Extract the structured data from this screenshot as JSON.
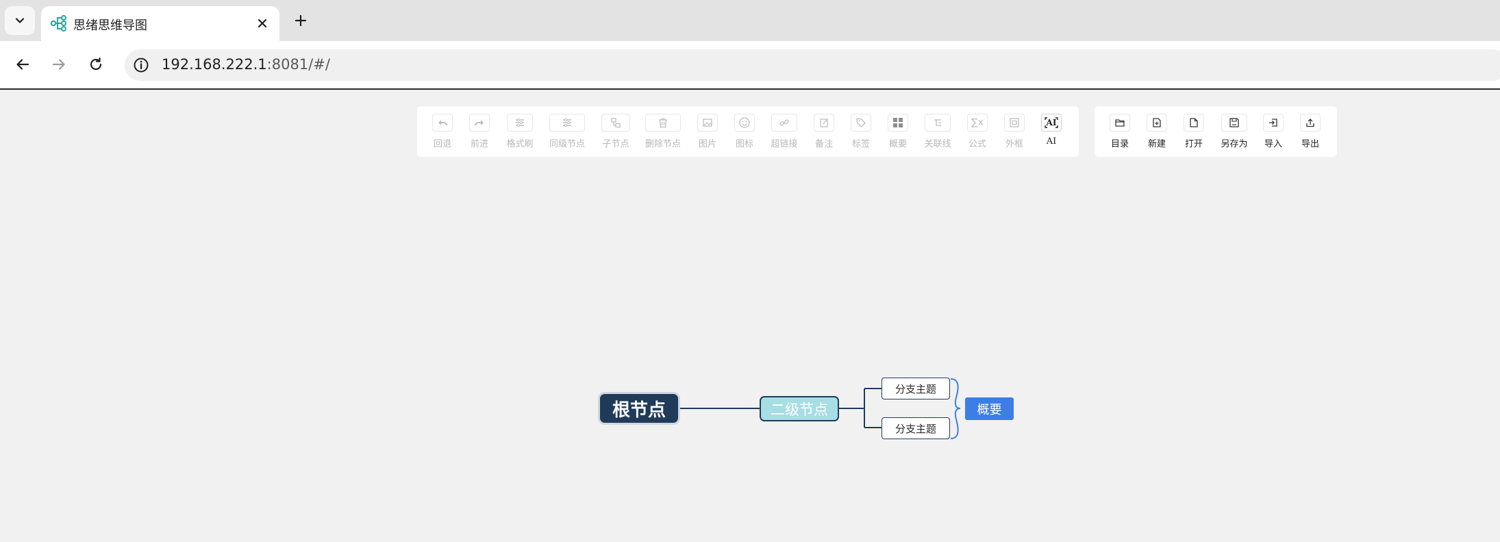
{
  "browser": {
    "tab": {
      "title": "思绪思维导图",
      "favicon": "mindmap-favicon-icon",
      "close": "close-icon"
    },
    "new_tab": "plus-icon",
    "address": {
      "host": "192.168.222.1",
      "rest": ":8081/#/"
    }
  },
  "toolbar": {
    "main_tools": [
      {
        "label": "回退",
        "icon": "undo-icon",
        "enabled": false
      },
      {
        "label": "前进",
        "icon": "redo-icon",
        "enabled": false
      },
      {
        "label": "格式刷",
        "icon": "format-painter-icon",
        "enabled": false
      },
      {
        "label": "同级节点",
        "icon": "sibling-node-icon",
        "enabled": false
      },
      {
        "label": "子节点",
        "icon": "child-node-icon",
        "enabled": false
      },
      {
        "label": "删除节点",
        "icon": "trash-icon",
        "enabled": false
      },
      {
        "label": "图片",
        "icon": "image-icon",
        "enabled": false
      },
      {
        "label": "图标",
        "icon": "smiley-icon",
        "enabled": false
      },
      {
        "label": "超链接",
        "icon": "link-icon",
        "enabled": false
      },
      {
        "label": "备注",
        "icon": "note-icon",
        "enabled": false
      },
      {
        "label": "标签",
        "icon": "tag-icon",
        "enabled": false
      },
      {
        "label": "概要",
        "icon": "summary-grid-icon",
        "enabled": false
      },
      {
        "label": "关联线",
        "icon": "relation-line-icon",
        "enabled": false
      },
      {
        "label": "公式",
        "icon": "formula-icon",
        "enabled": false
      },
      {
        "label": "外框",
        "icon": "outer-frame-icon",
        "enabled": false
      },
      {
        "label": "AI",
        "icon": "ai-icon",
        "enabled": true,
        "glyph": "AI"
      }
    ],
    "file_tools": [
      {
        "label": "目录",
        "icon": "folder-icon"
      },
      {
        "label": "新建",
        "icon": "new-file-icon"
      },
      {
        "label": "打开",
        "icon": "open-file-icon"
      },
      {
        "label": "另存为",
        "icon": "save-as-icon"
      },
      {
        "label": "导入",
        "icon": "import-icon"
      },
      {
        "label": "导出",
        "icon": "export-icon"
      }
    ],
    "formula_glyph": "∑x"
  },
  "mindmap": {
    "root": "根节点",
    "second": "二级节点",
    "branches": [
      "分支主题",
      "分支主题"
    ],
    "summary": "概要",
    "colors": {
      "root_bg": "#203a5a",
      "second_bg": "#a7dde4",
      "line": "#203a5a",
      "summary_bg": "#3d7ee6",
      "summary_bracket": "#3d7ee6"
    }
  }
}
